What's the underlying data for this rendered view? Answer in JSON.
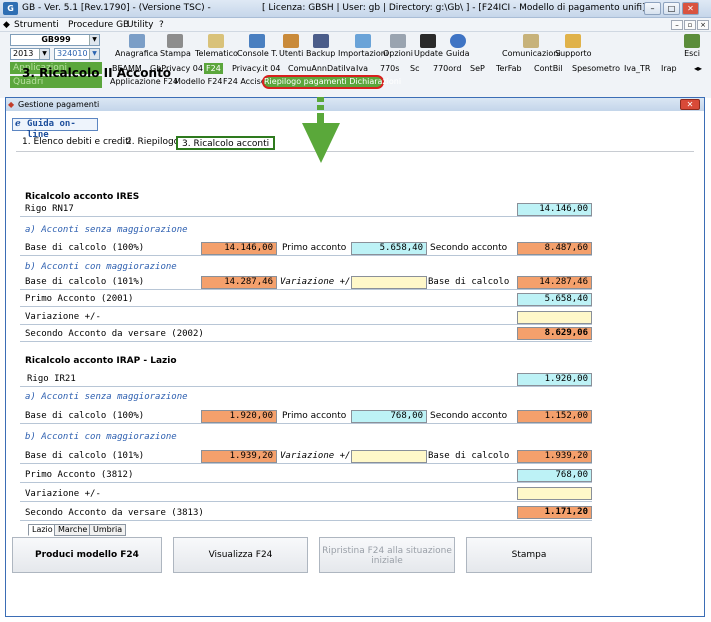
{
  "window": {
    "title": "GB - Ver. 5.1 [Rev.1790] - (Versione TSC) -",
    "license": "[ Licenza: GBSH | User: gb | Directory: g:\\Gb\\ ] - [F24ICI - Modello di pagamento unifi]"
  },
  "menu": {
    "items": [
      "Strumenti",
      "Procedure GB",
      "Utility",
      "?"
    ]
  },
  "toolbar": {
    "company": "GB999",
    "year": "2013",
    "code": "324010",
    "applicazioni": "Applicazioni",
    "quadri": "Quadri",
    "buttons": [
      "Anagrafica",
      "Stampa",
      "Telematico",
      "Console T.",
      "Utenti",
      "Backup",
      "Importazioni",
      "Opzioni",
      "Update",
      "Guida",
      "Comunicazioni",
      "Supporto",
      "Esci"
    ]
  },
  "tabs_row1": [
    "BEAMM",
    "GbPrivacy 04",
    "F24",
    "Privacy.it 04",
    "ComuAnnDatiIva",
    "Iva",
    "770s",
    "Sc",
    "770ord",
    "SeP",
    "TerFab",
    "ContBil",
    "Spesometro",
    "Iva_TR",
    "Irap"
  ],
  "tabs_row2": [
    "Applicazione F24",
    "Modello F24",
    "F24 Accise"
  ],
  "callout": "Riepilogo pagamenti Dichiarazioni",
  "panel": {
    "title": "Gestione pagamenti",
    "guida": "Guida on-line",
    "tabs": [
      "1. Elenco debiti e crediti",
      "2. Riepilogo",
      "3. Ricalcolo acconti"
    ],
    "section_title": "3. Ricalcolo II Acconto",
    "ires": {
      "header": "Ricalcolo acconto IRES",
      "rigo_label": "Rigo RN17",
      "rigo_value": "14.146,00",
      "sub_a": "a) Acconti senza maggiorazione",
      "base100_label": "Base di calcolo (100%)",
      "base100_value": "14.146,00",
      "primo_label": "Primo acconto",
      "primo_value": "5.658,40",
      "secondo_label": "Secondo acconto",
      "secondo_value": "8.487,60",
      "sub_b": "b) Acconti con maggiorazione",
      "base101_label": "Base di calcolo (101%)",
      "base101_value": "14.287,46",
      "var_label": "Variazione +/-",
      "var_value": "",
      "base_calc_label": "Base di calcolo",
      "base_calc_value": "14.287,46",
      "primo2001_label": "Primo Acconto (2001)",
      "primo2001_value": "5.658,40",
      "variazione_label": "Variazione +/-",
      "variazione_value": "",
      "secondo2002_label": "Secondo Acconto da versare (2002)",
      "secondo2002_value": "8.629,06"
    },
    "irap": {
      "header": "Ricalcolo acconto IRAP - Lazio",
      "rigo_label": "Rigo IR21",
      "rigo_value": "1.920,00",
      "sub_a": "a) Acconti senza maggiorazione",
      "base100_label": "Base di calcolo (100%)",
      "base100_value": "1.920,00",
      "primo_label": "Primo acconto",
      "primo_value": "768,00",
      "secondo_label": "Secondo acconto",
      "secondo_value": "1.152,00",
      "sub_b": "b) Acconti con maggiorazione",
      "base101_label": "Base di calcolo (101%)",
      "base101_value": "1.939,20",
      "var_label": "Variazione +/-",
      "var_value": "",
      "base_calc_label": "Base di calcolo",
      "base_calc_value": "1.939,20",
      "primo3812_label": "Primo Acconto (3812)",
      "primo3812_value": "768,00",
      "variazione_label": "Variazione +/-",
      "variazione_value": "",
      "secondo3813_label": "Secondo Acconto da versare (3813)",
      "secondo3813_value": "1.171,20"
    },
    "region_tabs": [
      "Lazio",
      "Marche",
      "Umbria"
    ],
    "buttons": {
      "produci": "Produci modello F24",
      "visualizza": "Visualizza F24",
      "ripristina": "Ripristina F24 alla situazione iniziale",
      "stampa": "Stampa"
    }
  }
}
